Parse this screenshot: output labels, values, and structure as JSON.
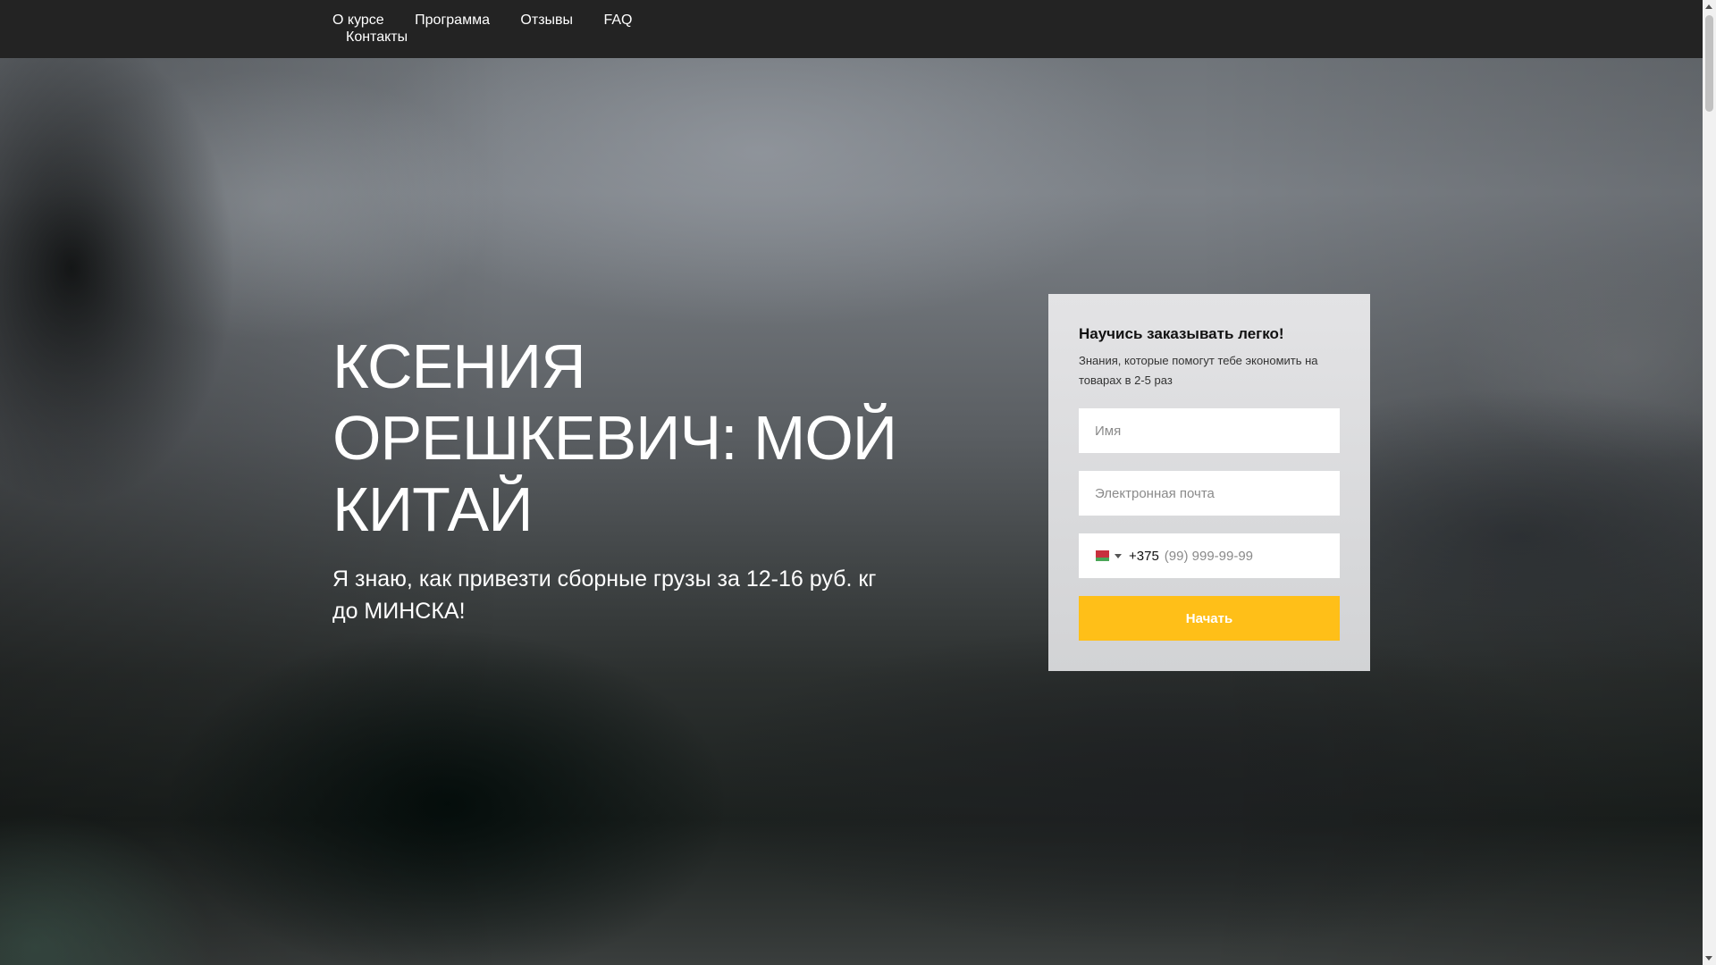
{
  "nav": {
    "items": [
      {
        "label": "О курсе"
      },
      {
        "label": "Программа"
      },
      {
        "label": "Отзывы"
      },
      {
        "label": "FAQ"
      },
      {
        "label": "Контакты"
      }
    ]
  },
  "hero": {
    "title": "КСЕНИЯ ОРЕШКЕВИЧ: МОЙ КИТАЙ",
    "subtitle": "Я знаю, как привезти сборные грузы за 12-16 руб. кг до МИНСКА!"
  },
  "form": {
    "title": "Научись заказывать легко!",
    "description": "Знания, которые помогут тебе экономить на товарах в 2-5 раз",
    "name_placeholder": "Имя",
    "email_placeholder": "Электронная почта",
    "phone_country_icon": "belarus-flag-icon",
    "phone_code": "+375",
    "phone_placeholder": "(99) 999-99-99",
    "submit_label": "Начать"
  },
  "colors": {
    "topbar": "#232323",
    "accent": "#ffbf18",
    "card": "#dcdcde"
  }
}
